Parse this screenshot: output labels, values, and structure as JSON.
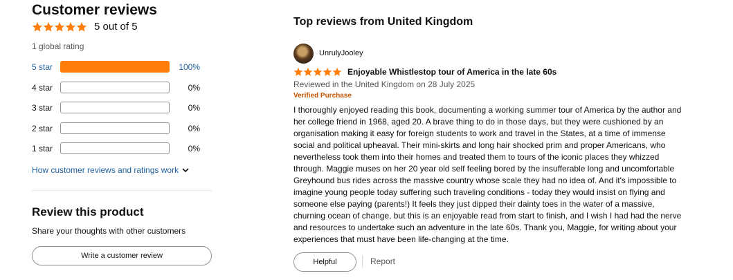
{
  "summary": {
    "title": "Customer reviews",
    "rating_value": 5,
    "rating_text": "5 out of 5",
    "global_rating": "1 global rating",
    "star_color": "#ff7d0a"
  },
  "histogram": [
    {
      "label": "5 star",
      "percent_text": "100%",
      "fill_percent": 100,
      "is_link": true
    },
    {
      "label": "4 star",
      "percent_text": "0%",
      "fill_percent": 0,
      "is_link": false
    },
    {
      "label": "3 star",
      "percent_text": "0%",
      "fill_percent": 0,
      "is_link": false
    },
    {
      "label": "2 star",
      "percent_text": "0%",
      "fill_percent": 0,
      "is_link": false
    },
    {
      "label": "1 star",
      "percent_text": "0%",
      "fill_percent": 0,
      "is_link": false
    }
  ],
  "how_link": "How customer reviews and ratings work",
  "review_product": {
    "title": "Review this product",
    "subtitle": "Share your thoughts with other customers",
    "button_label": "Write a customer review"
  },
  "top_reviews": {
    "title": "Top reviews from United Kingdom",
    "review": {
      "username": "UnrulyJooley",
      "rating_value": 5,
      "title": "Enjoyable Whistlestop tour of America in the late 60s",
      "date": "Reviewed in the United Kingdom on 28 July 2025",
      "verified": "Verified Purchase",
      "body_lines": [
        "I thoroughly enjoyed reading this book, documenting a working summer tour of America by the author and",
        "her college friend in 1968, aged 20. A brave thing to do in those days, but they were cushioned by an",
        "organisation making it easy for foreign students to work and travel in the States, at a time of immense",
        "social and political upheaval. Their mini-skirts and long hair shocked prim and proper Americans, who",
        "nevertheless took them into their homes and treated them to tours of the iconic places they whizzed",
        "through. Maggie muses on her 20 year old self feeling bored by the insufferable long and uncomfortable",
        "Greyhound bus rides across the massive country whose scale they had no idea of. And it's impossible to",
        "imagine young people today suffering such traveling conditions - today they would insist on flying and",
        "someone else paying (parents!) It feels they just dipped their dainty toes in the water of a massive,",
        "churning ocean of change, but this is an enjoyable read from start to finish, and I wish I had had the nerve",
        "and resources to undertake such an adventure in the late 60s. Thank you, Maggie, for writing about your",
        "experiences that must have been life-changing at the time."
      ],
      "helpful_label": "Helpful",
      "report_label": "Report"
    }
  }
}
